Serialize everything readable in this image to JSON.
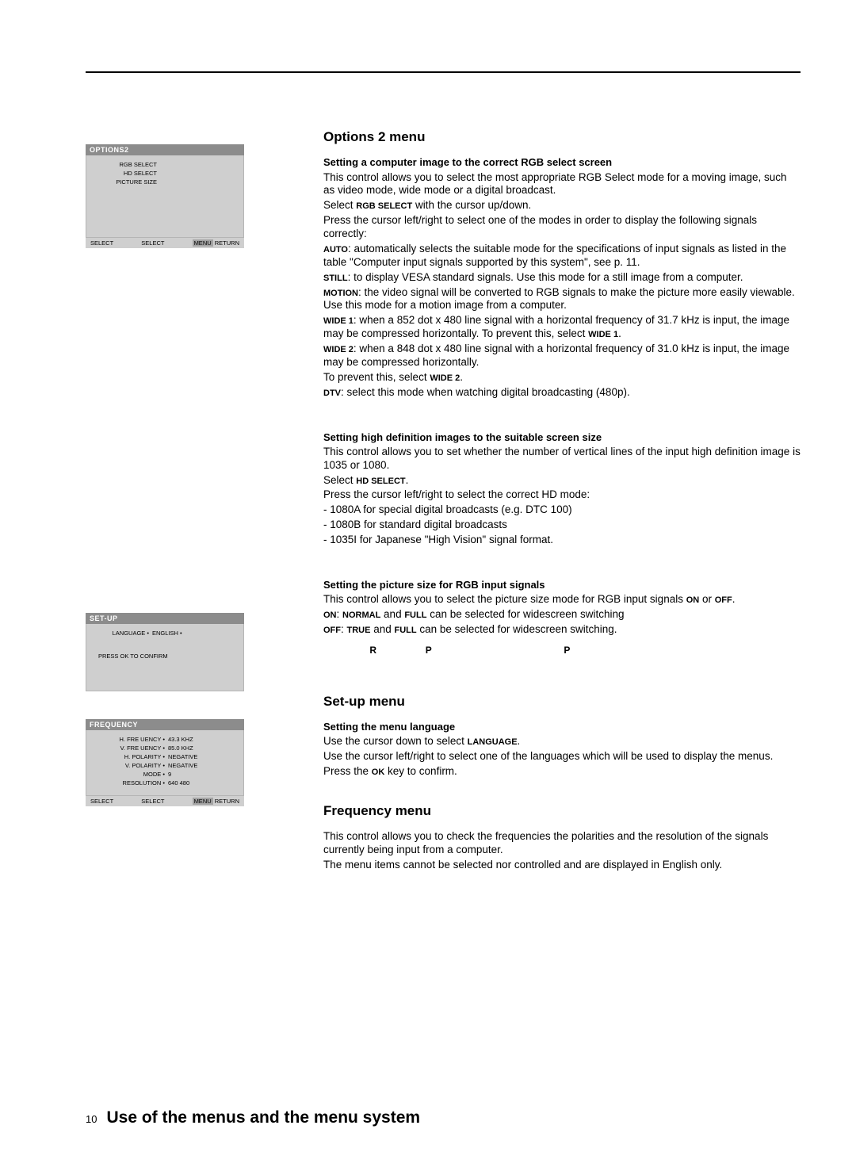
{
  "osd_options2": {
    "title": "OPTIONS2",
    "rows": [
      {
        "label": "RGB  SELECT",
        "value": ""
      },
      {
        "label": "HD  SELECT",
        "value": ""
      },
      {
        "label": "PICTURE SIZE",
        "value": ""
      }
    ],
    "footer": {
      "l": "SELECT",
      "m": "SELECT",
      "menu": "MENU",
      "r": "RETURN"
    }
  },
  "osd_setup": {
    "title": "SET-UP",
    "rows": [
      {
        "label": "LANGUAGE •",
        "value": "ENGLISH •"
      }
    ],
    "hint": "PRESS OK TO CONFIRM"
  },
  "osd_frequency": {
    "title": "FREQUENCY",
    "rows": [
      {
        "label": "H. FRE UENCY  •",
        "value": "43.3 KHZ"
      },
      {
        "label": "V. FRE UENCY •",
        "value": "85.0 KHZ"
      },
      {
        "label": "H. POLARITY •",
        "value": "NEGATIVE"
      },
      {
        "label": "V. POLARITY •",
        "value": "NEGATIVE"
      },
      {
        "label": "MODE •",
        "value": "9"
      },
      {
        "label": "RESOLUTION •",
        "value": "640   480"
      }
    ],
    "footer": {
      "l": "SELECT",
      "m": "SELECT",
      "menu": "MENU",
      "r": "RETURN"
    }
  },
  "sections": {
    "options2_heading": "Options 2 menu",
    "rgb_sub": "Setting a computer image to the correct RGB select screen",
    "rgb_intro": "This control allows you to select the most appropriate RGB Select mode for a moving image, such as video mode, wide mode or a digital broadcast.",
    "rgb_select_line_pre": "Select ",
    "rgb_select_label": "RGB SELECT",
    "rgb_select_line_post": " with the cursor up/down.",
    "rgb_press": "Press the cursor left/right to select one of the modes in order to display the following signals correctly:",
    "auto_label": "AUTO",
    "auto_text": ": automatically selects the suitable mode for the specifications of input signals as listed in the table \"Computer input signals supported by this system\", see p. 11.",
    "still_label": "STILL",
    "still_text": ": to display VESA standard signals. Use this mode for a still image from a computer.",
    "motion_label": "MOTION",
    "motion_text": ": the video signal will be converted to RGB signals to make the picture more easily viewable. Use this mode for a motion image from a computer.",
    "wide1_label": "WIDE 1",
    "wide1_text": ": when a 852 dot x 480 line signal with a horizontal frequency of 31.7 kHz is input, the image may be compressed horizontally. To prevent this, select ",
    "wide1_end": "WIDE 1",
    "wide1_dot": ".",
    "wide2_label": "WIDE 2",
    "wide2_text": ": when a 848 dot x 480 line signal with a horizontal frequency of 31.0 kHz is input, the image may be compressed horizontally.",
    "wide2_prevent_pre": "To prevent this, select ",
    "wide2_prevent_label": "WIDE 2",
    "wide2_prevent_dot": ".",
    "dtv_label": "DTV",
    "dtv_text": ": select this mode when watching digital broadcasting (480p).",
    "hd_sub": "Setting high definition images to the suitable screen size",
    "hd_intro": "This control allows you to set whether the number of vertical lines of the input high definition image is 1035 or 1080.",
    "hd_select_pre": " Select ",
    "hd_select_label": "HD SELECT",
    "hd_select_dot": ".",
    "hd_press": " Press the cursor left/right to select the correct HD mode:",
    "hd_1080a": "- 1080A for special digital broadcasts (e.g. DTC 100)",
    "hd_1080b": "- 1080B for standard digital broadcasts",
    "hd_1035i": "- 1035I for Japanese \"High Vision\" signal format.",
    "ps_sub": "Setting the picture size for RGB input signals",
    "ps_intro_pre": "This control allows you to select the picture size mode for RGB input signals ",
    "ps_on": "ON",
    "ps_or": " or ",
    "ps_off": "OFF",
    "ps_dot": ".",
    "ps_on_label": "ON",
    "ps_on_sep": ": ",
    "ps_normal": "NORMAL",
    "ps_and1": " and ",
    "ps_full1": "FULL",
    "ps_on_post": " can be selected for widescreen switching",
    "ps_off_label": "OFF",
    "ps_off_sep": ": ",
    "ps_true": "TRUE",
    "ps_and2": " and ",
    "ps_full2": "FULL",
    "ps_off_post": " can be selected for widescreen switching.",
    "note_r": "R",
    "note_p1": "P",
    "note_p2": "P",
    "setup_heading": "Set-up menu",
    "setup_sub": "Setting the menu language",
    "setup_use_pre": "Use the cursor down to select ",
    "setup_lang": "LANGUAGE",
    "setup_use_dot": ".",
    "setup_select": "Use the cursor left/right to select one of the languages which will be used to display the menus.",
    "setup_press_pre": "Press the ",
    "setup_ok": "OK",
    "setup_press_post": " key to confirm.",
    "freq_heading": "Frequency menu",
    "freq_text1": "This control allows you to check the frequencies the polarities and the resolution of the signals currently being input from a computer.",
    "freq_text2": "The menu items cannot be selected nor controlled and are displayed in English only."
  },
  "footer": {
    "page_number": "10",
    "page_title": "Use of the menus and the menu system"
  }
}
